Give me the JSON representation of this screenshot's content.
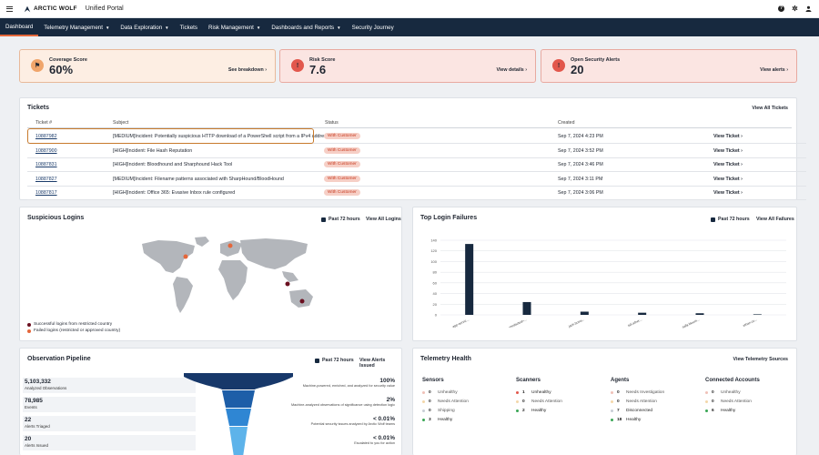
{
  "app": {
    "logo_text": "ARCTIC WOLF",
    "portal_name": "Unified Portal"
  },
  "top_icons": {
    "help": "question-icon",
    "settings": "gear-icon",
    "user": "user-icon"
  },
  "nav": {
    "items": [
      {
        "label": "Dashboard",
        "active": true,
        "dropdown": false
      },
      {
        "label": "Telemetry Management",
        "dropdown": true
      },
      {
        "label": "Data Exploration",
        "dropdown": true
      },
      {
        "label": "Tickets",
        "dropdown": false
      },
      {
        "label": "Risk Management",
        "dropdown": true
      },
      {
        "label": "Dashboards and Reports",
        "dropdown": true
      },
      {
        "label": "Security Journey",
        "dropdown": false
      }
    ]
  },
  "scores": [
    {
      "label": "Coverage Score",
      "value": "60%",
      "link": "See breakdown",
      "bg": "#fdeee3",
      "border": "#e8b99a",
      "badge_bg": "#f0a56b",
      "icon": "flag-icon"
    },
    {
      "label": "Risk Score",
      "value": "7.6",
      "link": "View details",
      "bg": "#fbe5e2",
      "border": "#e8a9a0",
      "badge_bg": "#e2574c",
      "icon": "warning-icon"
    },
    {
      "label": "Open Security Alerts",
      "value": "20",
      "link": "View alerts",
      "bg": "#fbe5e2",
      "border": "#e8a9a0",
      "badge_bg": "#e2574c",
      "icon": "warning-icon"
    }
  ],
  "tickets": {
    "title": "Tickets",
    "view_all": "View All Tickets",
    "columns": [
      "Ticket #",
      "Subject",
      "Status",
      "Created"
    ],
    "rows": [
      {
        "id": "10887982",
        "subject": "[MEDIUM]Incident: Potentially suspicious HTTP download of a PowerShell script from a IPv4 address",
        "status": "With Customer",
        "created": "Sep 7, 2024 4:23 PM",
        "action": "View Ticket"
      },
      {
        "id": "10887900",
        "subject": "[HIGH]Incident: File Hash Reputation",
        "status": "With Customer",
        "created": "Sep 7, 2024 3:52 PM",
        "action": "View Ticket"
      },
      {
        "id": "10887831",
        "subject": "[HIGH]Incident: Bloodhound and Sharphound Hack Tool",
        "status": "With Customer",
        "created": "Sep 7, 2024 3:46 PM",
        "action": "View Ticket"
      },
      {
        "id": "10887827",
        "subject": "[MEDIUM]Incident: Filename patterns associated with SharpHound/BloodHound",
        "status": "With Customer",
        "created": "Sep 7, 2024 3:11 PM",
        "action": "View Ticket"
      },
      {
        "id": "10887817",
        "subject": "[HIGH]Incident: Office 365: Evasive Inbox rule configured",
        "status": "With Customer",
        "created": "Sep 7, 2024 3:06 PM",
        "action": "View Ticket"
      }
    ]
  },
  "suspicious_logins": {
    "title": "Suspicious Logins",
    "range": "Past 72 hours",
    "view_all": "View All Logins",
    "legend": [
      {
        "label": "Successful logins from restricted country",
        "color": "#6b1020"
      },
      {
        "label": "Failed logins (restricted or approved country)",
        "color": "#e4673b"
      }
    ]
  },
  "top_login_failures": {
    "title": "Top Login Failures",
    "range": "Past 72 hours",
    "view_all": "View All Failures"
  },
  "chart_data": {
    "type": "bar",
    "categories": [
      "app-servic...",
      "<redacted>...",
      "jack.bosw...",
      "tali.ather...",
      "sally.bloom...",
      "ethan.co..."
    ],
    "values": [
      133,
      24,
      6,
      4,
      3,
      1
    ],
    "ylim": [
      0,
      140
    ],
    "yticks": [
      0,
      20,
      40,
      60,
      80,
      100,
      120,
      140
    ],
    "grid": true,
    "color": "#17293f"
  },
  "pipeline": {
    "title": "Observation Pipeline",
    "range": "Past 72 hours",
    "view_all": "View Alerts Issued",
    "stages": [
      {
        "value": "5,103,332",
        "label": "Analyzed Observations",
        "pct": "100%",
        "desc": "Machine-powered, enriched, and analyzed for security value"
      },
      {
        "value": "78,985",
        "label": "Events",
        "pct": "2%",
        "desc": "Machine-analyzed observations of significance using detection logic"
      },
      {
        "value": "22",
        "label": "Alerts Triaged",
        "pct": "< 0.01%",
        "desc": "Potential security issues analyzed by Arctic Wolf teams"
      },
      {
        "value": "20",
        "label": "Alerts Issued",
        "pct": "< 0.01%",
        "desc": "Escalated to you for action"
      }
    ],
    "colors": [
      "#17386a",
      "#1d5ea8",
      "#2f86d3",
      "#5db3ea"
    ]
  },
  "telemetry": {
    "title": "Telemetry Health",
    "view_all": "View Telemetry Sources",
    "groups": [
      {
        "title": "Sensors",
        "items": [
          {
            "count": "0",
            "label": "Unhealthy",
            "color": "#f0c1b8"
          },
          {
            "count": "0",
            "label": "Needs Attention",
            "color": "#f3d7a9"
          },
          {
            "count": "0",
            "label": "Shipping",
            "color": "#c9ced6"
          },
          {
            "count": "3",
            "label": "Healthy",
            "color": "#3aa655",
            "healthy": true
          }
        ]
      },
      {
        "title": "Scanners",
        "items": [
          {
            "count": "1",
            "label": "Unhealthy",
            "color": "#e2574c",
            "healthy": true
          },
          {
            "count": "0",
            "label": "Needs Attention",
            "color": "#f3d7a9"
          },
          {
            "count": "2",
            "label": "Healthy",
            "color": "#3aa655",
            "healthy": true
          }
        ]
      },
      {
        "title": "Agents",
        "items": [
          {
            "count": "0",
            "label": "Needs Investigation",
            "color": "#f0c1b8"
          },
          {
            "count": "0",
            "label": "Needs Attention",
            "color": "#f3d7a9"
          },
          {
            "count": "7",
            "label": "Disconnected",
            "color": "#c9ced6",
            "healthy": true
          },
          {
            "count": "18",
            "label": "Healthy",
            "color": "#3aa655",
            "healthy": true
          }
        ]
      },
      {
        "title": "Connected Accounts",
        "items": [
          {
            "count": "0",
            "label": "Unhealthy",
            "color": "#f0c1b8"
          },
          {
            "count": "0",
            "label": "Needs Attention",
            "color": "#f3d7a9"
          },
          {
            "count": "6",
            "label": "Healthy",
            "color": "#3aa655",
            "healthy": true
          }
        ]
      }
    ]
  }
}
